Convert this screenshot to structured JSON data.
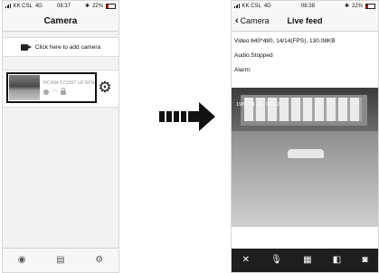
{
  "left_screen": {
    "status": {
      "carrier": "KK CSL",
      "network": "4G",
      "time": "08:37",
      "battery": "22%"
    },
    "title": "Camera",
    "add_camera_label": "Click here to add camera",
    "device": {
      "name": "RCAM-073397-UFSFN",
      "status_icons": [
        "online-dot-icon",
        "wifi-icon",
        "lock-icon"
      ]
    },
    "tabs": [
      {
        "label": "",
        "icon": "camera-tab-icon"
      },
      {
        "label": "",
        "icon": "gallery-tab-icon"
      },
      {
        "label": "",
        "icon": "settings-tab-icon"
      }
    ]
  },
  "right_screen": {
    "status": {
      "carrier": "KK CSL",
      "network": "4G",
      "time": "08:38",
      "battery": "22%"
    },
    "back_label": "Camera",
    "title": "Live feed",
    "video_info": "Video:640*480, 14/14(FPS), 130.08KB",
    "audio_info": "Audio:Stopped",
    "alarm_info": "Alarm:",
    "video_timestamp": "1905 01 01 02:22",
    "controls": [
      "mute-icon",
      "microphone-icon",
      "qr-icon",
      "record-icon",
      "snapshot-icon"
    ]
  },
  "colors": {
    "accent": "#111111",
    "bar": "#f7f7f7",
    "control_bar": "#1e1e1e"
  }
}
